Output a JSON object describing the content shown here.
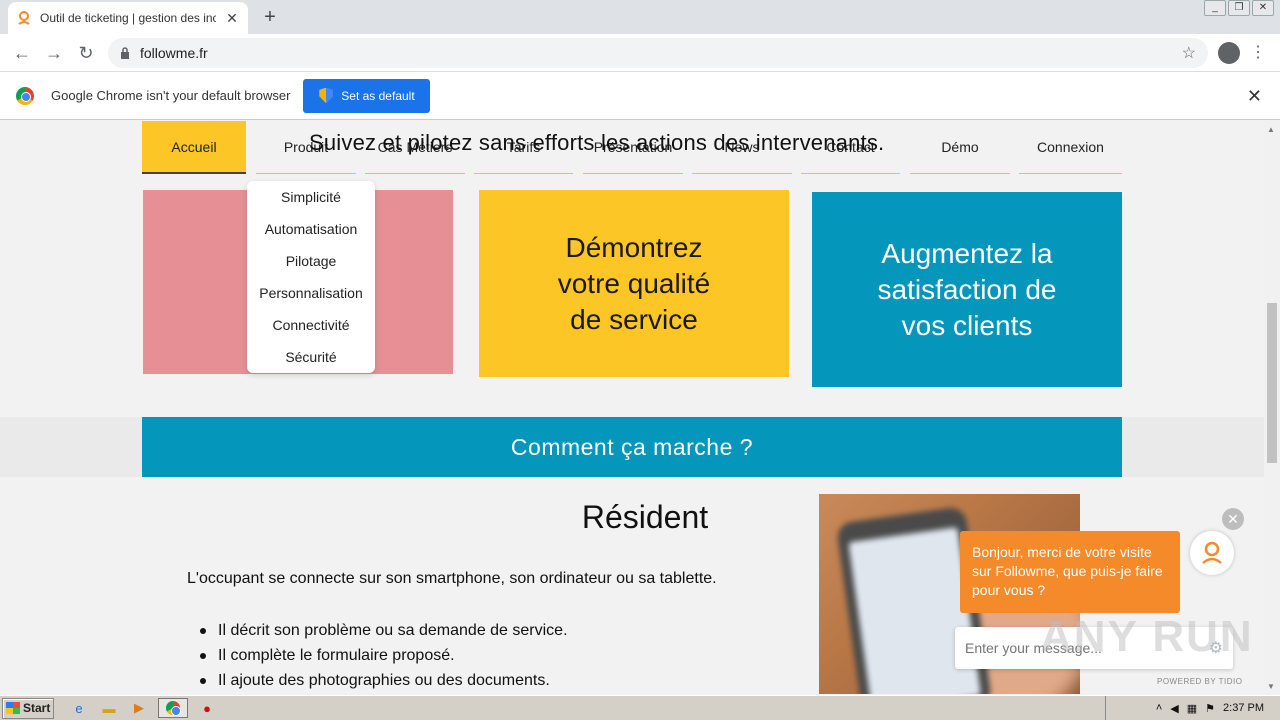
{
  "browser": {
    "tab_title": "Outil de ticketing | gestion des incide",
    "url": "followme.fr",
    "infobar_text": "Google Chrome isn't your default browser",
    "set_default_label": "Set as default"
  },
  "nav": {
    "items": [
      "Accueil",
      "Produit",
      "Cas Métiers",
      "Tarifs",
      "Présentation",
      "News",
      "Contact",
      "Démo",
      "Connexion"
    ],
    "headline": "Suivez et pilotez sans efforts les actions des intervenants."
  },
  "dropdown": {
    "items": [
      "Simplicité",
      "Automatisation",
      "Pilotage",
      "Personnalisation",
      "Connectivité",
      "Sécurité"
    ]
  },
  "cards": {
    "yellow": [
      "Démontrez",
      "votre qualité",
      "de service"
    ],
    "blue": [
      "Augmentez la",
      "satisfaction de",
      "vos clients"
    ]
  },
  "how_it_works": "Comment ça marche ?",
  "resident": {
    "title": "Résident",
    "intro": "L'occupant  se connecte sur son smartphone, son ordinateur ou sa tablette.",
    "bullets": [
      "Il décrit son problème ou sa demande de service.",
      "Il complète le formulaire proposé.",
      "Il ajoute des photographies ou des documents."
    ]
  },
  "chat": {
    "message": "Bonjour, merci de votre visite sur Followme, que puis-je faire pour vous ?",
    "placeholder": "Enter your message...",
    "powered_by": "POWERED BY TIDIO"
  },
  "watermark": "ANY RUN",
  "taskbar": {
    "start_label": "Start",
    "clock": "2:37 PM"
  },
  "colors": {
    "accent_yellow": "#fcc626",
    "accent_blue": "#0597bb",
    "accent_pink": "#e69096",
    "chat_orange": "#f58a2a"
  }
}
